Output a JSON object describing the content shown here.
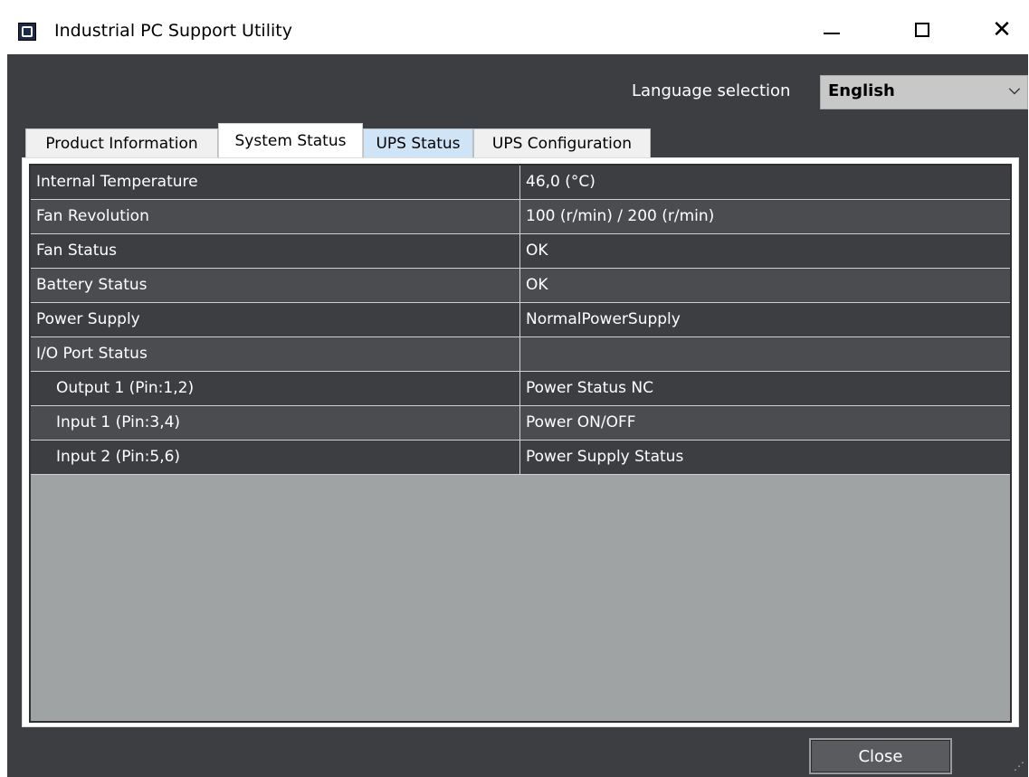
{
  "window": {
    "title": "Industrial PC Support Utility",
    "app_icon": "app-logo-icon",
    "controls": {
      "minimize_icon": "minimize-icon",
      "maximize_icon": "maximize-icon",
      "close_icon": "close-icon",
      "close_glyph": "✕"
    }
  },
  "language": {
    "label": "Language selection",
    "selected": "English",
    "chevron": "⌵"
  },
  "tabs": [
    {
      "label": "Product Information"
    },
    {
      "label": "System Status",
      "active": true
    },
    {
      "label": "UPS Status"
    },
    {
      "label": "UPS Configuration"
    }
  ],
  "status_table": {
    "rows": [
      {
        "key": "Internal Temperature",
        "value": "46,0 (°C)"
      },
      {
        "key": "Fan Revolution",
        "value": "100 (r/min) / 200 (r/min)"
      },
      {
        "key": "Fan Status",
        "value": "OK"
      },
      {
        "key": "Battery Status",
        "value": "OK"
      },
      {
        "key": "Power Supply",
        "value": "NormalPowerSupply"
      },
      {
        "key": "I/O Port Status",
        "value": ""
      },
      {
        "key": "Output 1 (Pin:1,2)",
        "value": "Power Status NC"
      },
      {
        "key": "Input 1 (Pin:3,4)",
        "value": "Power ON/OFF"
      },
      {
        "key": "Input 2 (Pin:5,6)",
        "value": "Power Supply Status"
      }
    ]
  },
  "footer": {
    "close_label": "Close"
  },
  "colors": {
    "window_bg": "#3d3e42",
    "row_odd": "#3d3e42",
    "row_even": "#4b4c50",
    "grid_empty": "#a0a3a4",
    "ups_tab_bg": "#cfe4f7"
  }
}
